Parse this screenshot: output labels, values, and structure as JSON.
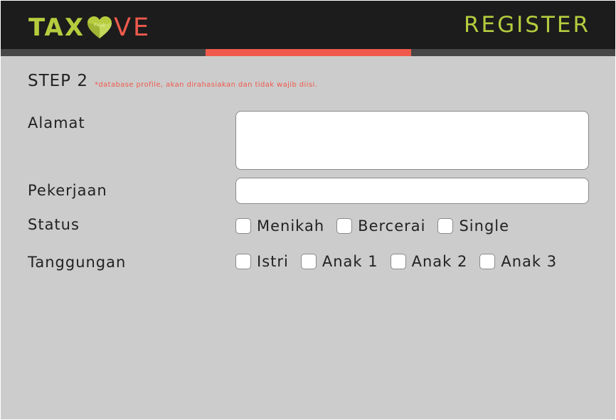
{
  "header": {
    "logo_tax": "TAX",
    "logo_heart_text": "Pajak",
    "logo_ve": "VE",
    "title": "REGISTER"
  },
  "progress": {
    "step": 2,
    "fill_start_fraction": 0.333,
    "fill_end_fraction": 0.667,
    "fill_color": "#ef5a4c",
    "track_color": "#474747"
  },
  "colors": {
    "accent_green": "#b6cc3e",
    "accent_red": "#ef5a4c",
    "header_bg": "#1c1c1c",
    "body_bg": "#cccccc"
  },
  "step": {
    "title": "STEP 2",
    "note": "*database profile, akan dirahasiakan dan tidak wajib diisi."
  },
  "form": {
    "alamat": {
      "label": "Alamat",
      "value": "",
      "placeholder": ""
    },
    "pekerjaan": {
      "label": "Pekerjaan",
      "value": "",
      "placeholder": ""
    },
    "status": {
      "label": "Status",
      "options": [
        {
          "label": "Menikah",
          "checked": false
        },
        {
          "label": "Bercerai",
          "checked": false
        },
        {
          "label": "Single",
          "checked": false
        }
      ]
    },
    "tanggungan": {
      "label": "Tanggungan",
      "options": [
        {
          "label": "Istri",
          "checked": false
        },
        {
          "label": "Anak 1",
          "checked": false
        },
        {
          "label": "Anak 2",
          "checked": false
        },
        {
          "label": "Anak 3",
          "checked": false
        }
      ]
    }
  }
}
